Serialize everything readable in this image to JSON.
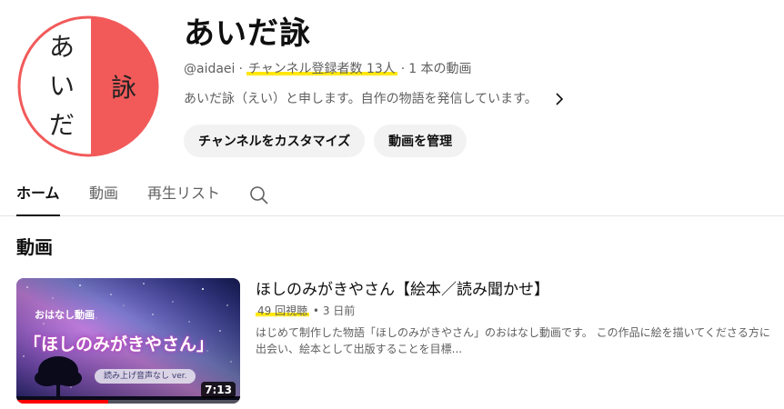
{
  "channel": {
    "name": "あいだ詠",
    "handle": "@aidaei",
    "subscribers": "チャンネル登録者数 13人",
    "video_count": "1 本の動画",
    "description": "あいだ詠（えい）と申します。自作の物語を発信しています。",
    "avatar": {
      "left_text": [
        "あ",
        "い",
        "だ"
      ],
      "right_text": "詠",
      "accent": "#f25a5a"
    },
    "buttons": {
      "customize": "チャンネルをカスタマイズ",
      "manage": "動画を管理"
    }
  },
  "tabs": [
    {
      "label": "ホーム",
      "active": true
    },
    {
      "label": "動画",
      "active": false
    },
    {
      "label": "再生リスト",
      "active": false
    }
  ],
  "section": {
    "title": "動画"
  },
  "video": {
    "title": "ほしのみがきやさん【絵本／読み聞かせ】",
    "views": "49 回視聴",
    "age": "3 日前",
    "description": "はじめて制作した物語「ほしのみがきやさん」のおはなし動画です。 この作品に絵を描いてくださる方に出会い、絵本として出版することを目標...",
    "duration": "7:13",
    "watched_fraction": 0.41,
    "thumbnail": {
      "small_text": "おはなし動画",
      "big_text": "「ほしのみがきやさん」",
      "pill_text": "読み上げ音声なし ver."
    }
  },
  "colors": {
    "highlight": "#ffe600",
    "progress": "#ff0000"
  },
  "icons": {
    "search": "search-icon",
    "chevron": "chevron-right-icon"
  }
}
